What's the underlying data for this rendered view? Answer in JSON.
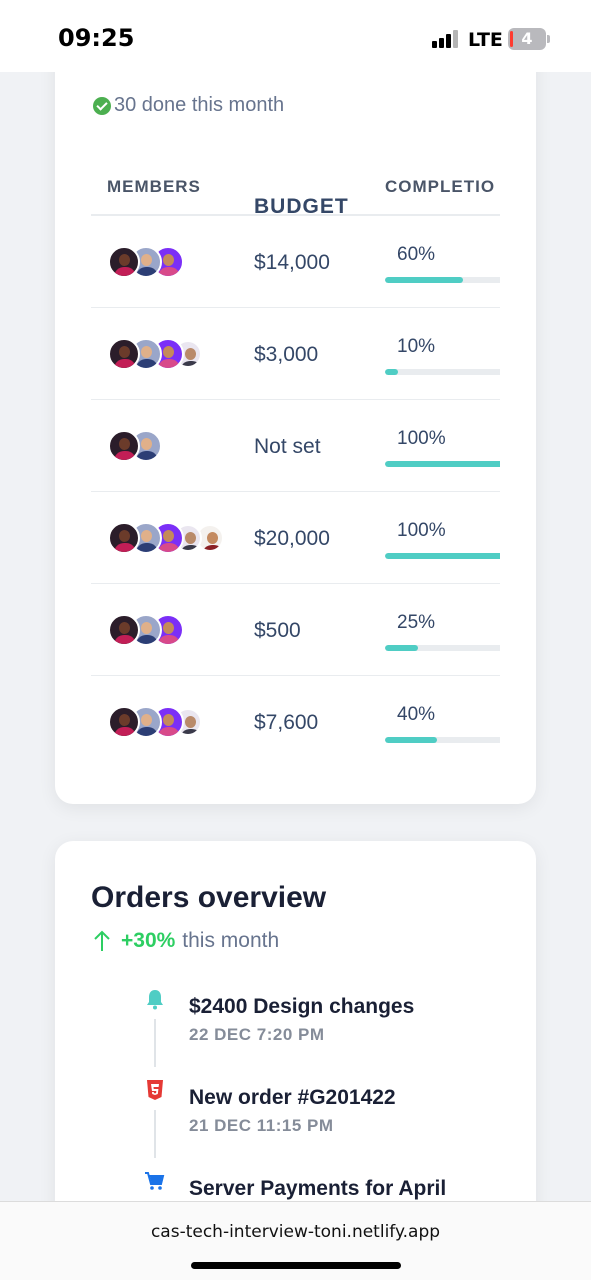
{
  "status_bar": {
    "time": "09:25",
    "network": "LTE",
    "battery": "4"
  },
  "projects": {
    "done_text": "30 done this month",
    "columns": [
      "MEMBERS",
      "BUDGET",
      "COMPLETIO"
    ],
    "rows": [
      {
        "members": 3,
        "budget": "$14,000",
        "completion": "60%",
        "progress": 0.6
      },
      {
        "members": 4,
        "budget": "$3,000",
        "completion": "10%",
        "progress": 0.1
      },
      {
        "members": 2,
        "budget": "Not set",
        "completion": "100%",
        "progress": 1.0
      },
      {
        "members": 5,
        "budget": "$20,000",
        "completion": "100%",
        "progress": 1.0
      },
      {
        "members": 3,
        "budget": "$500",
        "completion": "25%",
        "progress": 0.25
      },
      {
        "members": 4,
        "budget": "$7,600",
        "completion": "40%",
        "progress": 0.4
      }
    ],
    "progress_color": "#4fcdc4"
  },
  "orders": {
    "title": "Orders overview",
    "trend_value": "+30%",
    "trend_label": "this month",
    "trend_color": "#2dce62",
    "items": [
      {
        "icon": "bell-icon",
        "title": "$2400 Design changes",
        "date": "22 DEC 7:20 PM",
        "color": "#4fcdc4"
      },
      {
        "icon": "html5-icon",
        "title": "New order #G201422",
        "date": "21 DEC 11:15 PM",
        "color": "#e53935"
      },
      {
        "icon": "cart-icon",
        "title": "Server Payments for April",
        "date": "",
        "color": "#1a73e8"
      }
    ]
  },
  "browser": {
    "url": "cas-tech-interview-toni.netlify.app"
  }
}
